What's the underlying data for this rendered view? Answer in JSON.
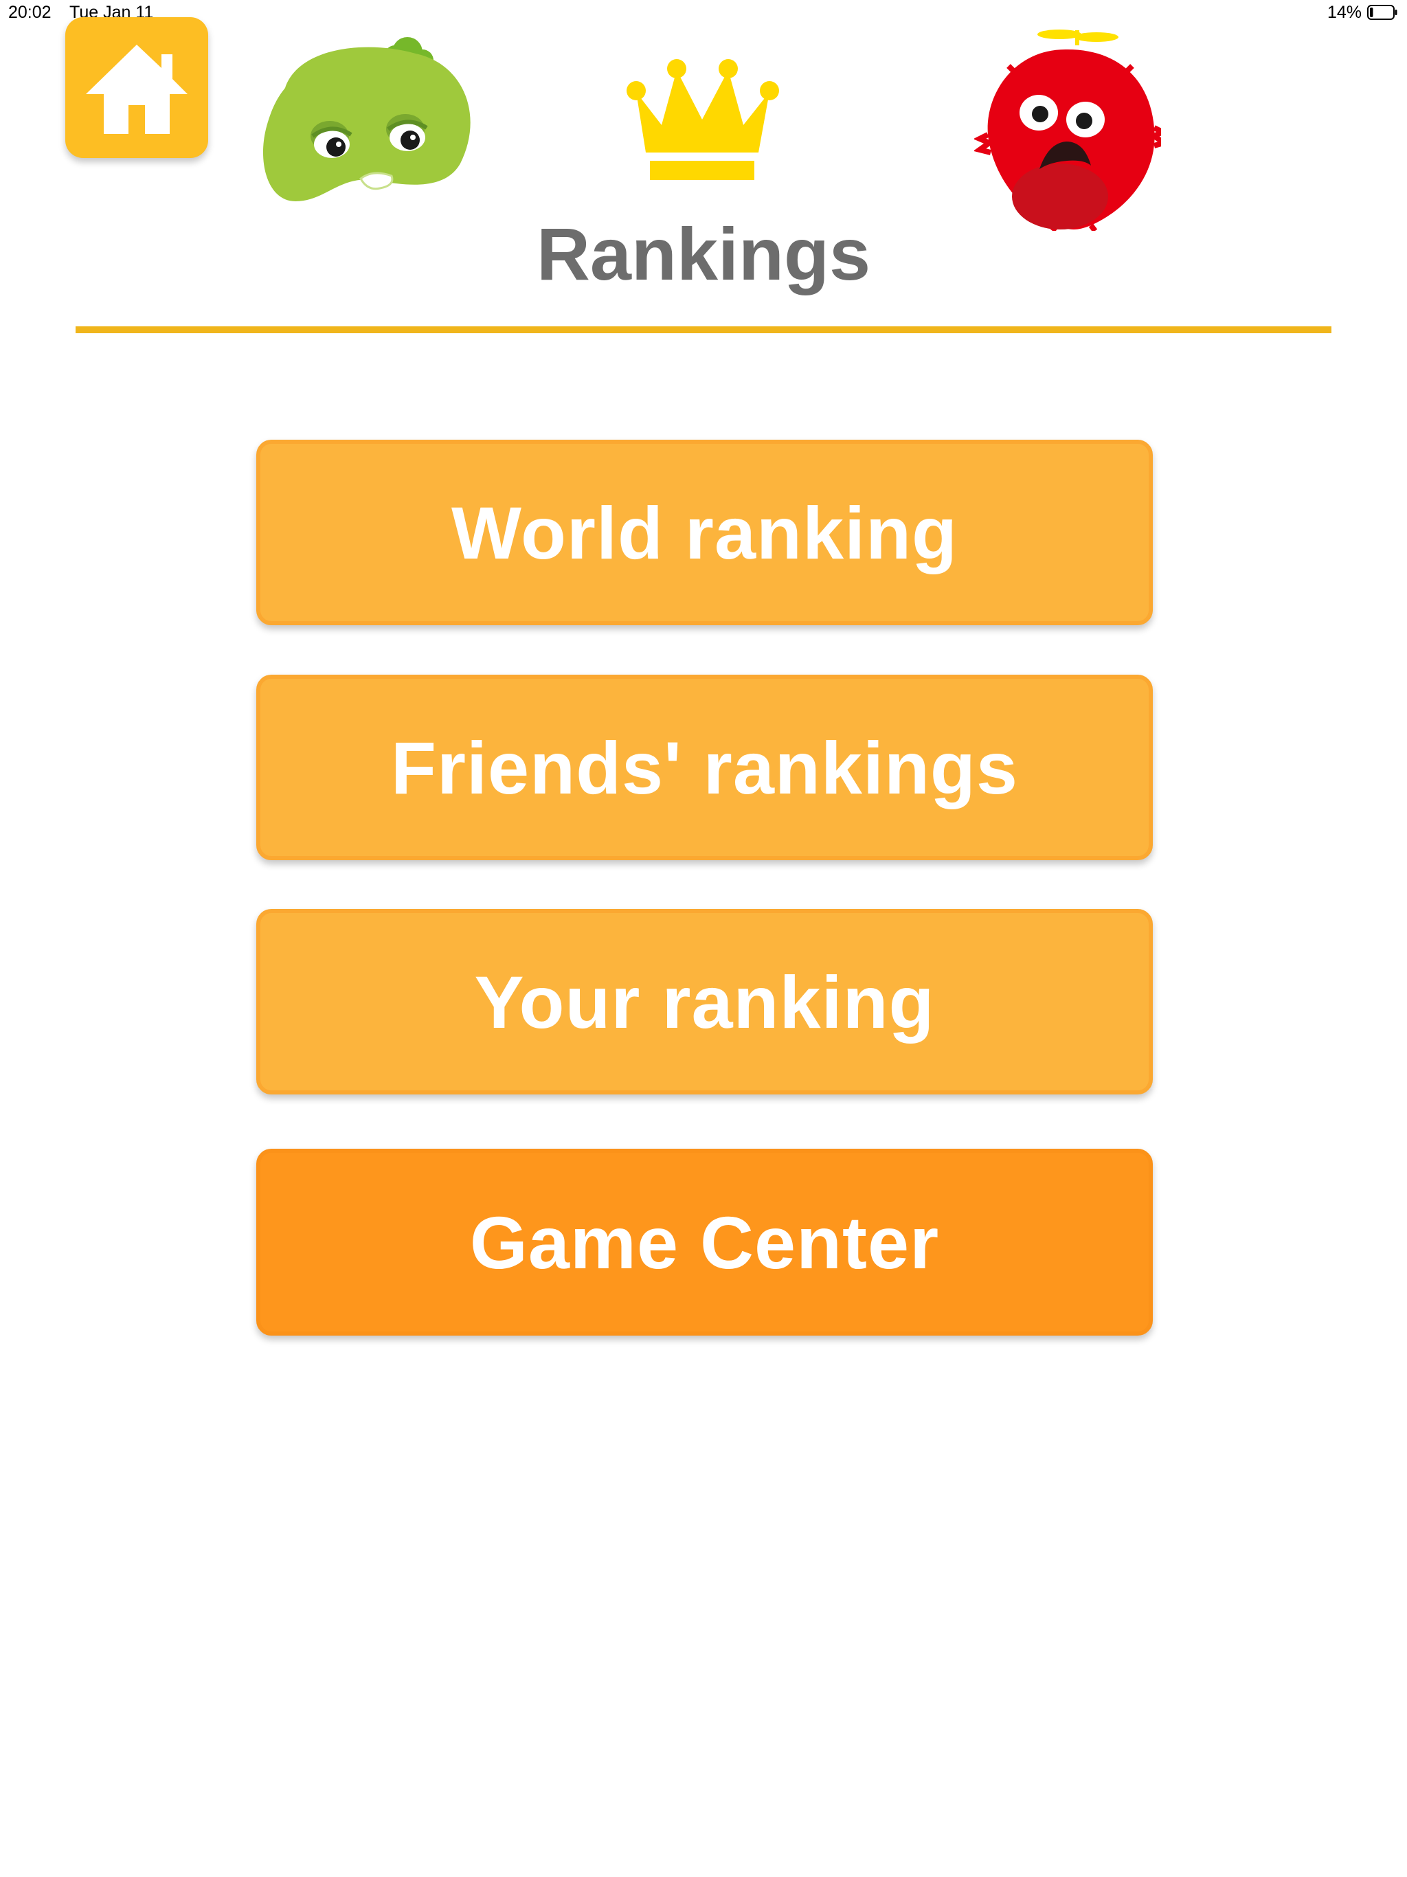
{
  "status_bar": {
    "time": "20:02",
    "date": "Tue Jan 11",
    "battery_percent": "14%",
    "battery_level": 0.14
  },
  "header": {
    "home_icon": "home-icon",
    "title": "Rankings",
    "decorations": [
      "green-mascot-icon",
      "crown-icon",
      "red-mascot-icon"
    ]
  },
  "menu": {
    "world_ranking": "World ranking",
    "friends_rankings": "Friends' rankings",
    "your_ranking": "Your ranking",
    "game_center": "Game Center"
  },
  "colors": {
    "button_orange": "#fcb43d",
    "game_center_orange": "#fe961c",
    "home_yellow": "#fdbe23",
    "divider_gold": "#f0b51b",
    "title_gray": "#6d6d6d"
  }
}
